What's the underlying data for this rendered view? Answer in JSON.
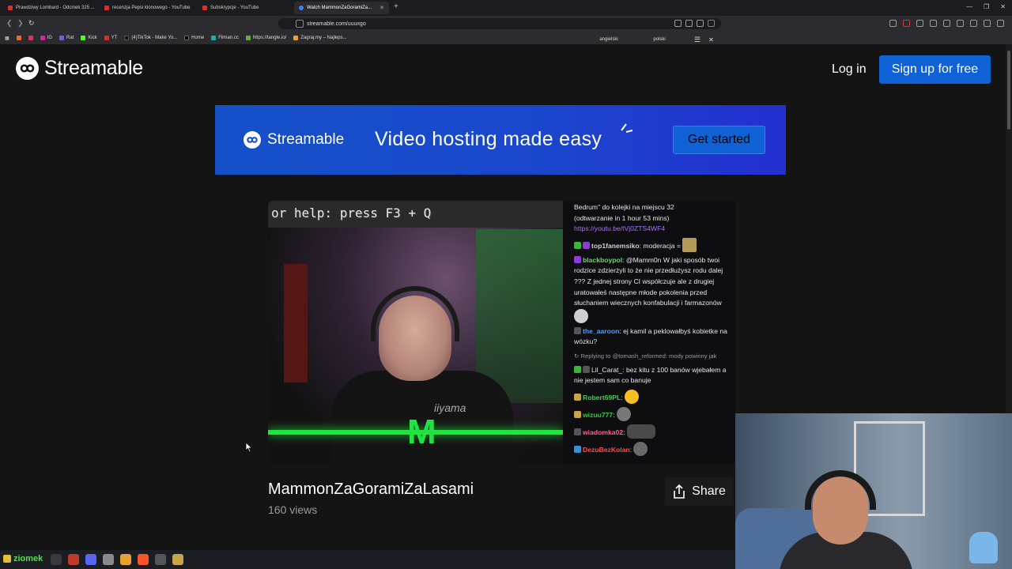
{
  "browser": {
    "tabs": [
      {
        "label": "Prawdziwy Lombard - Odcinek 325 ..."
      },
      {
        "label": "recenzja Pepsi klonowego - YouTube"
      },
      {
        "label": "Subskrypcje - YouTube"
      },
      {
        "label": "Watch MammonZaGoramiZa..."
      }
    ],
    "url": "streamable.com/uuuxgo",
    "bookmarks": [
      "IG",
      "Rat",
      "Kick",
      "YT",
      "(4)TikTok - Make Yo...",
      "Home",
      "Filman.cc",
      "https://tangle.io/",
      "Zagraj.my – Najleps..."
    ],
    "translate": {
      "lang_a": "angielski",
      "lang_b": "polski"
    }
  },
  "site": {
    "logo_text": "Streamable",
    "login": "Log in",
    "signup": "Sign up for free"
  },
  "banner": {
    "logo_text": "Streamable",
    "tagline": "Video hosting made easy",
    "cta": "Get started"
  },
  "video": {
    "overlay_text": "or help: press F3 + Q",
    "monitor_brand": "iiyama",
    "title": "MammonZaGoramiZaLasami",
    "views": "160 views",
    "share": "Share"
  },
  "chat": {
    "intro_1": "Bedrum\" do kolejki na miejscu 32",
    "intro_2": "(odtwarzanie in 1 hour 53 mins)",
    "intro_link": "https://youtu.be/tVj0ZTS4WF4",
    "messages": [
      {
        "user": "top1fanemsiko",
        "text": ": moderacja =",
        "color": "#4b9c5a"
      },
      {
        "user": "blackboypol",
        "text": ": @Mamm0n W jaki sposób twoi rodzice zdzierżyli to że nie przedłużysz rodu dalej ??? Z jednej strony CI współczuje ale z drugiej uratowałeś następne młode pokolenia przed słuchaniem wiecznych konfabulacji i farmazonów",
        "color": "#6cd66c"
      },
      {
        "user": "the_aaroon",
        "text": ": ej kamil a peklowałbyś kobietke na wózku?",
        "color": "#4aa0ff"
      },
      {
        "reply": "Replying to @tomash_reformed: mody powinny jak"
      },
      {
        "user": "Lil_Carat_",
        "text": ": bez kitu z 100 banów wjebałem a nie jestem sam co banuje",
        "color": "#e8e8e8"
      },
      {
        "user": "Robert69PL",
        "text": ":",
        "color": "#37d44e"
      },
      {
        "user": "wizuu777",
        "text": ":",
        "color": "#31c93d"
      },
      {
        "user": "wiadomka02",
        "text": ":",
        "color": "#ff5f8f"
      },
      {
        "user": "DezuBezKolan",
        "text": ":",
        "color": "#ff4a4a"
      }
    ]
  },
  "taskbar": {
    "label": "ziomek"
  },
  "colors": {
    "brand_blue": "#0f62d6",
    "page_bg": "#141414",
    "chat_link": "#a970ff"
  }
}
